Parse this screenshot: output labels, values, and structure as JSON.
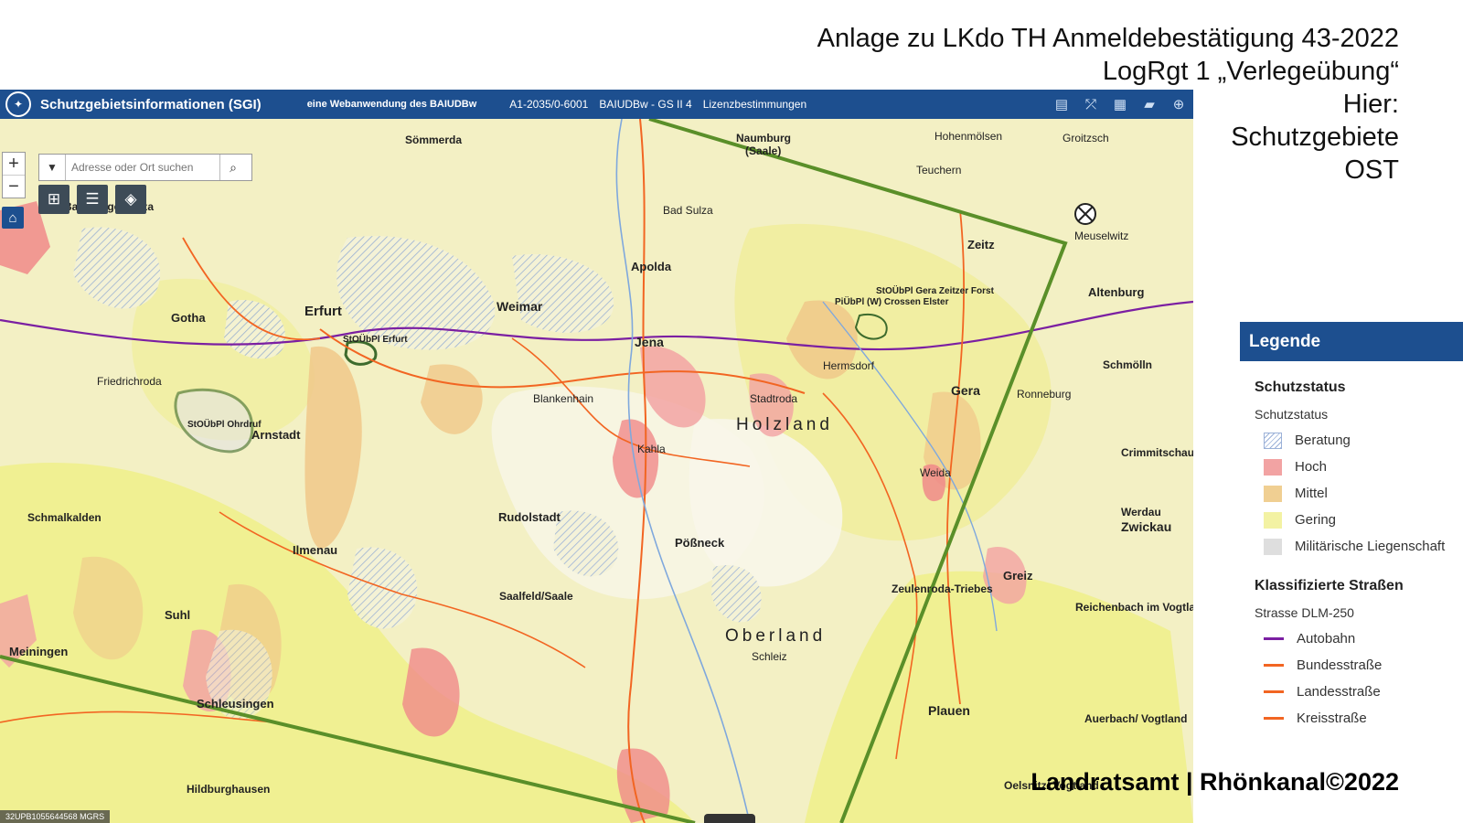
{
  "caption": {
    "line1": "Anlage zu LKdo TH Anmeldebestätigung 43-2022",
    "line2": "LogRgt 1 „Verlegeübung“",
    "line3": "Hier:",
    "line4": "Schutzgebiete",
    "line5": "OST"
  },
  "topbar": {
    "title": "Schutzgebietsinformationen (SGI)",
    "subtitle": "eine Webanwendung des BAIUDBw",
    "link1": "A1-2035/0-6001",
    "link2": "BAIUDBw - GS II 4",
    "link3": "Lizenzbestimmungen"
  },
  "search": {
    "placeholder": "Adresse oder Ort suchen"
  },
  "coords": "32UPB1055644568 MGRS",
  "map_labels": {
    "sommerda": "Sömmerda",
    "naumburg": "Naumburg",
    "saale": "(Saale)",
    "hohenmolsen": "Hohenmölsen",
    "groitzsch": "Groitzsch",
    "bad_langensalza": "Bad Langensalza",
    "bad_sulza": "Bad Sulza",
    "teuchern": "Teuchern",
    "zeitz": "Zeitz",
    "meuselwitz": "Meuselwitz",
    "apolda": "Apolda",
    "erfurt": "Erfurt",
    "weimar": "Weimar",
    "gotha": "Gotha",
    "jena": "Jena",
    "altenburg": "Altenburg",
    "arnstadt": "Arnstadt",
    "blankenhain": "Blankenhain",
    "gera": "Gera",
    "holzland": "Holzland",
    "stadtroda": "Stadtroda",
    "kahla": "Kahla",
    "hermsdorf": "Hermsdorf",
    "ilmenau": "Ilmenau",
    "rudolstadt": "Rudolstadt",
    "possneck": "Pößneck",
    "weida": "Weida",
    "werdau": "Werdau",
    "zwickau": "Zwickau",
    "suhl": "Suhl",
    "saalfeld": "Saalfeld/Saale",
    "greiz": "Greiz",
    "zeulenroda": "Zeulenroda-Triebes",
    "reichenbach": "Reichenbach im Vogtland",
    "oberland": "Oberland",
    "meiningen": "Meiningen",
    "schleusingen": "Schleusingen",
    "plauen": "Plauen",
    "hildburghausen": "Hildburghausen",
    "stoubpl_erfurt": "StOÜbPl Erfurt",
    "stoubpl_ohrdruf": "StOÜbPl Ohrdruf",
    "stoubpl_gera": "StOÜbPl Gera Zeitzer Forst",
    "piubpl": "PiÜbPl (W) Crossen Elster",
    "schmalkalden": "Schmalkalden",
    "friedrichroda": "Friedrichroda",
    "auerbach": "Auerbach/ Vogtland",
    "oelsnitz": "Oelsnitz/ Vogtland",
    "crimmitschau": "Crimmitschau",
    "schmolln": "Schmölln",
    "ronneburg": "Ronneburg",
    "schleiz": "Schleiz"
  },
  "legend": {
    "header": "Legende",
    "section1": "Schutzstatus",
    "section1_sub": "Schutzstatus",
    "status_items": [
      {
        "label": "Beratung",
        "color": "#9bb1d8"
      },
      {
        "label": "Hoch",
        "color": "#f2a3a3"
      },
      {
        "label": "Mittel",
        "color": "#f0cf92"
      },
      {
        "label": "Gering",
        "color": "#f3f2a3"
      },
      {
        "label": "Militärische Liegenschaft",
        "color": "#dedede"
      }
    ],
    "section2": "Klassifizierte Straßen",
    "section2_sub": "Strasse DLM-250",
    "road_items": [
      {
        "label": "Autobahn",
        "color": "#7b1fa2"
      },
      {
        "label": "Bundesstraße",
        "color": "#f26522"
      },
      {
        "label": "Landesstraße",
        "color": "#f26522"
      },
      {
        "label": "Kreisstraße",
        "color": "#f26522"
      }
    ]
  },
  "footer": "Landratsamt | Rhönkanal©2022"
}
